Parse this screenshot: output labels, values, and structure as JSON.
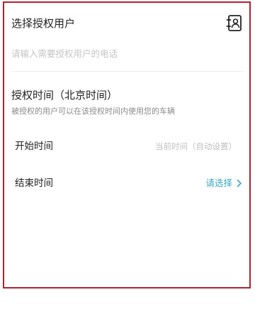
{
  "header": {
    "title": "选择授权用户",
    "contacts_icon": "contact-book-icon"
  },
  "phone_input": {
    "value": "",
    "placeholder": "请输入需要授权用户的电话"
  },
  "auth_time": {
    "title": "授权时间（北京时间）",
    "subtitle": "被授权的用户可以在该授权时间内使用您的车辆",
    "start": {
      "label": "开始时间",
      "value": "当前时间（自动设置）"
    },
    "end": {
      "label": "结束时间",
      "value": "请选择",
      "icon": "chevron-right-icon"
    }
  },
  "colors": {
    "accent": "#3ba7c2",
    "highlight_border": "#b51f2e",
    "placeholder": "#c4c4c4",
    "muted_text": "#8a8a8a"
  }
}
